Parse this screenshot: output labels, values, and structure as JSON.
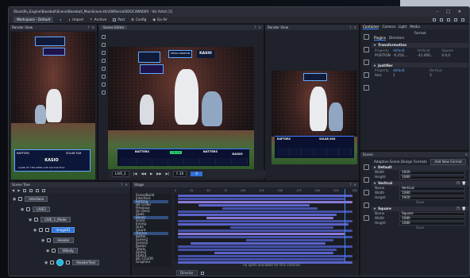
{
  "window": {
    "title": "\\Ross\\Ro_Engine\\Baseball\\Scene\\Baseball_MainScene.tts\\GWSerial\\XDOC4W0005 - Viz Artist [1]",
    "controls": [
      "–",
      "□",
      "✕"
    ]
  },
  "toolbar": {
    "workspace": "Workspace - Default",
    "items": [
      "Import",
      "Archive",
      "Post",
      "Config",
      "Go Air"
    ],
    "right_icons": [
      "layout-a-icon",
      "layout-b-icon",
      "layout-c-icon",
      "layout-d-icon",
      "layout-e-icon"
    ]
  },
  "panels": {
    "render_left": "Render View",
    "scene_editor": "Scene Editor",
    "render_right": "Render View",
    "scene_tree": "Scene Tree",
    "stage": "Stage",
    "scene_bottom": "Scene"
  },
  "broadcast": {
    "brand": "KASIO",
    "team_away": "RAPTORS",
    "team_home": "SOLAR SOX",
    "main_team_a": "BATTERS",
    "main_team_b": "BATTERS",
    "small_label": "GAME OF THE WEEK LIVE ON FOX/TIVO",
    "bottom_left": "RAPTORS",
    "bottom_right": "SOLAR SOX",
    "top_small": "SHOGI SNATION",
    "red_tag": "HUN",
    "green_tag": "ON 2B"
  },
  "transport": {
    "clip": "LIVE_1",
    "time": "F 20",
    "frame": "0",
    "controls": [
      "|◀",
      "◀◀",
      "▶",
      "▶▶",
      "▶|"
    ]
  },
  "scene_tree": {
    "rows": [
      {
        "label": "Interface",
        "indent": 0
      },
      {
        "label": "LIVE1",
        "indent": 1
      },
      {
        "label": "LIVE_1_Mode",
        "indent": 2
      },
      {
        "label": "ImageS1",
        "indent": 2,
        "selected": true
      },
      {
        "label": "Header",
        "indent": 3
      },
      {
        "label": "ViBody",
        "indent": 3
      },
      {
        "label": "HeaderText",
        "indent": 4
      }
    ]
  },
  "stage": {
    "tracks": [
      "SceneBuild",
      "Interface",
      "Batting",
      "Hit Order",
      "Previous",
      "On Deck",
      "Stats",
      "Bases",
      "Score",
      "Inning",
      "Outs",
      "Count",
      "Pitcher",
      "Batter",
      "Scene1",
      "Scene2",
      "Roster",
      "Totals",
      "Stats2",
      "Stats3",
      "BG COLOR",
      "Graphics"
    ],
    "highlight_tracks": [
      2,
      7,
      12
    ],
    "ruler": [
      "0",
      "25",
      "50",
      "75",
      "100",
      "125",
      "150",
      "175",
      "200",
      "225",
      "250"
    ],
    "empty_message": "no splits available for this channel",
    "footer_select": "Director"
  },
  "inspector": {
    "tabs": [
      "Container",
      "Camera",
      "Light",
      "Media"
    ],
    "subtitle": "Format",
    "sub_tabs": [
      "Plugins",
      "Directors"
    ],
    "transformation": {
      "title": "Transformation",
      "headers": [
        "Property",
        "default",
        "Vertical",
        "Square"
      ],
      "row": [
        "POSITION",
        "-0.250,...",
        "-41.000...",
        "0.0,0"
      ]
    },
    "justifier": {
      "title": "Justifier",
      "headers": [
        "Property",
        "default",
        "Vertical"
      ],
      "row": [
        "Axis",
        "1",
        "3"
      ]
    }
  },
  "scene_panel": {
    "title": "Adaptive Scene Design Formats",
    "add_button": "Add New Format",
    "default": {
      "title": "Default",
      "fields": [
        {
          "label": "Width",
          "value": "1920"
        },
        {
          "label": "Height",
          "value": "1080"
        }
      ]
    },
    "vertical": {
      "title": "Vertical",
      "fields": [
        {
          "label": "Name",
          "value": "Vertical"
        },
        {
          "label": "Width",
          "value": "1080"
        },
        {
          "label": "Height",
          "value": "1920"
        }
      ],
      "save": "Save"
    },
    "square": {
      "title": "Square",
      "fields": [
        {
          "label": "Name",
          "value": "Square"
        },
        {
          "label": "Width",
          "value": "1080"
        },
        {
          "label": "Height",
          "value": "1080"
        }
      ],
      "save": "Save"
    }
  }
}
